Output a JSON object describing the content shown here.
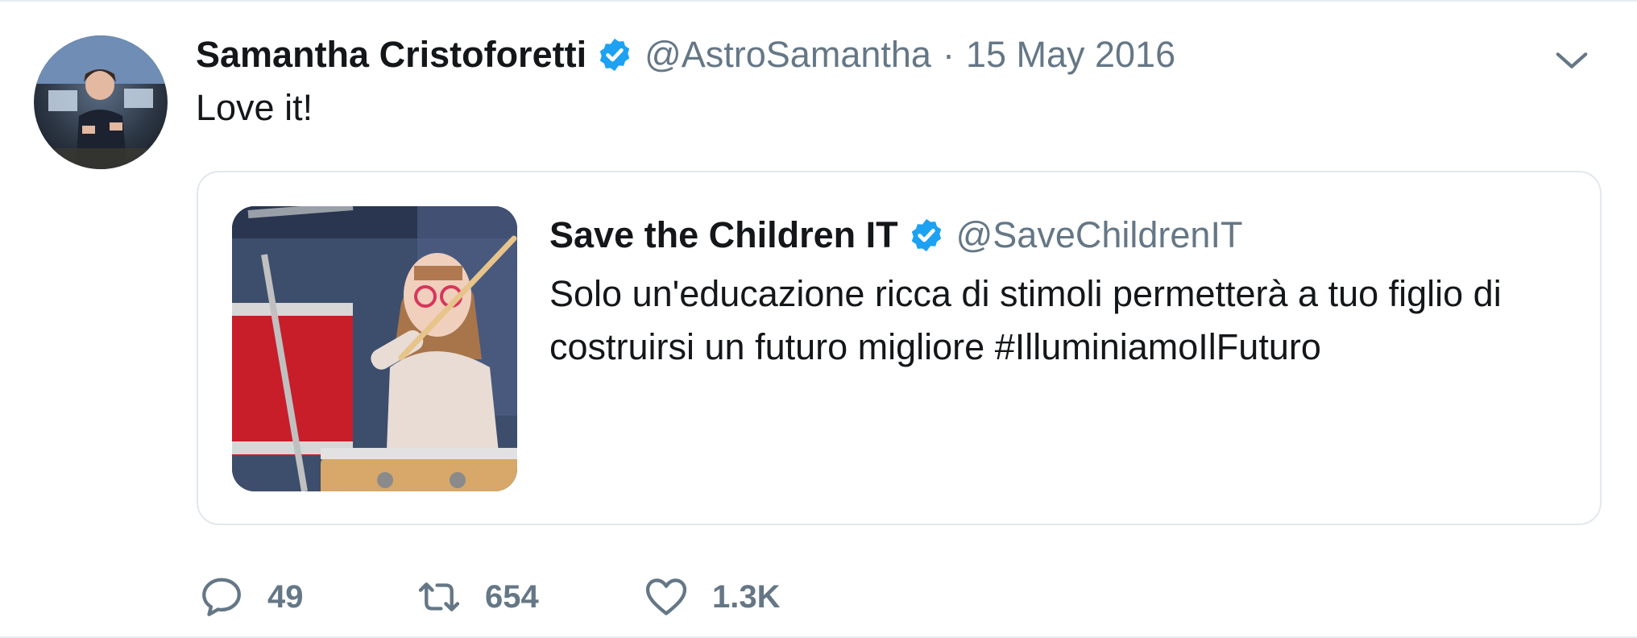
{
  "tweet": {
    "author_name": "Samantha Cristoforetti",
    "author_handle": "@AstroSamantha",
    "separator": "·",
    "date": "15 May 2016",
    "text": "Love it!"
  },
  "quoted_tweet": {
    "author_name": "Save the Children IT",
    "author_handle": "@SaveChildrenIT",
    "text": "Solo un'educazione ricca di stimoli permetterà a tuo figlio di costruirsi un futuro migliore #IlluminiamoIlFuturo"
  },
  "actions": {
    "reply_count": "49",
    "retweet_count": "654",
    "like_count": "1.3K"
  },
  "colors": {
    "verified": "#1da1f2",
    "secondary_text": "#657786",
    "border": "#e1e8ed"
  },
  "icons": {
    "verified": "verified-badge-icon",
    "caret": "chevron-down-icon",
    "reply": "reply-icon",
    "retweet": "retweet-icon",
    "like": "heart-icon"
  }
}
